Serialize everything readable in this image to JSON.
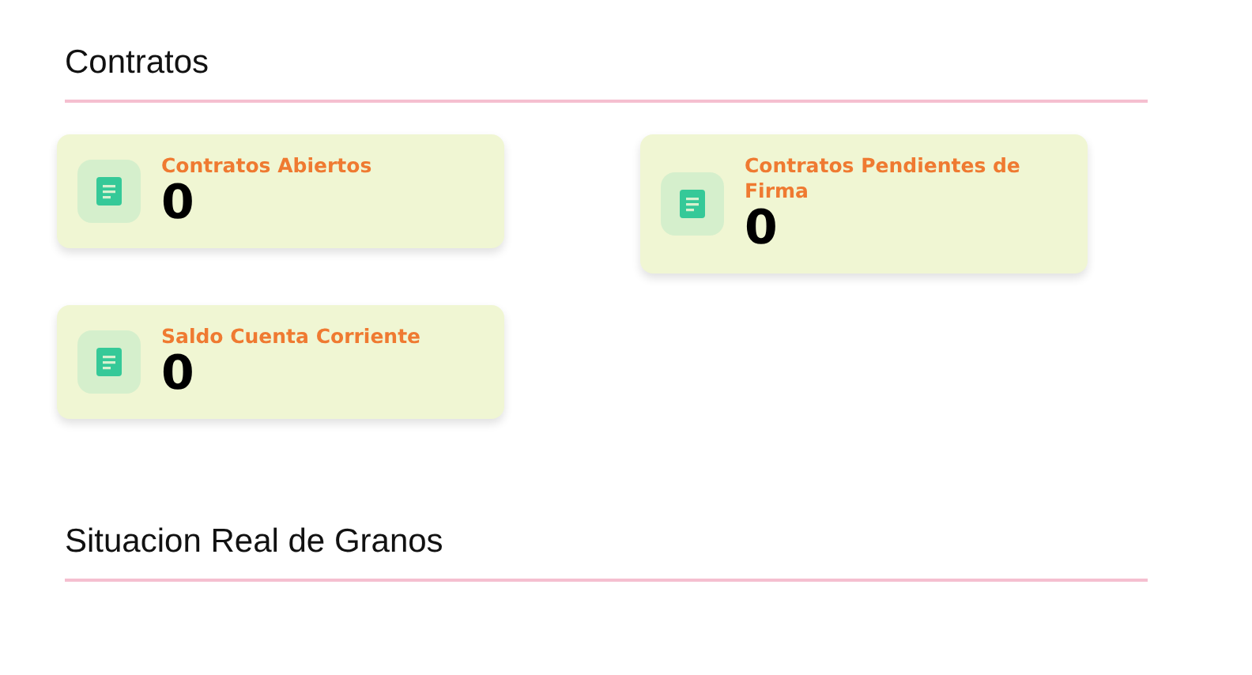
{
  "sections": [
    {
      "title": "Contratos",
      "cards": [
        {
          "label": "Contratos Abiertos",
          "value": "0"
        },
        {
          "label": "Contratos Pendientes de Firma",
          "value": "0"
        },
        {
          "label": "Saldo Cuenta Corriente",
          "value": "0"
        }
      ]
    },
    {
      "title": "Situacion Real de Granos"
    }
  ]
}
